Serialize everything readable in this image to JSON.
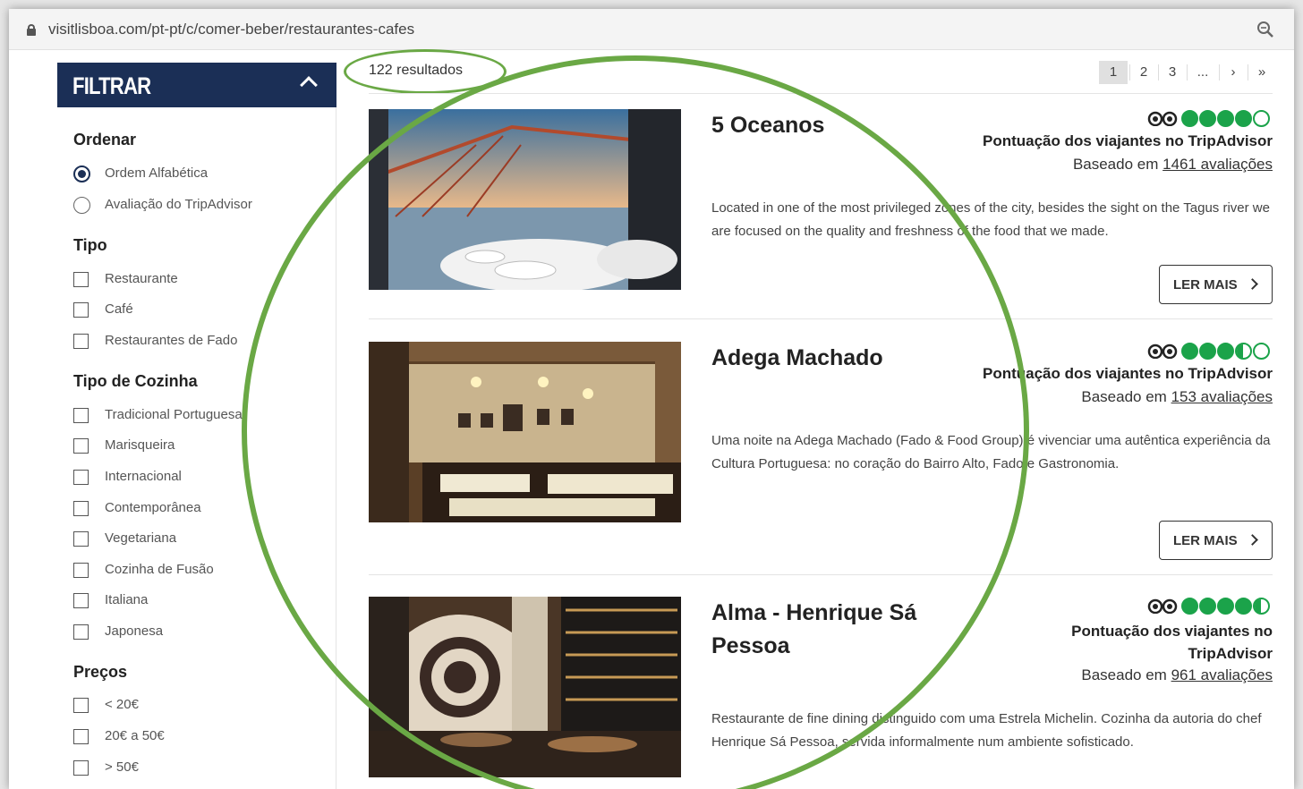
{
  "browser": {
    "url": "visitlisboa.com/pt-pt/c/comer-beber/restaurantes-cafes"
  },
  "sidebar": {
    "title": "FILTRAR",
    "groups": {
      "ordenar": {
        "title": "Ordenar",
        "options": [
          "Ordem Alfabética",
          "Avaliação do TripAdvisor"
        ],
        "selected": "Ordem Alfabética"
      },
      "tipo": {
        "title": "Tipo",
        "options": [
          "Restaurante",
          "Café",
          "Restaurantes de Fado"
        ]
      },
      "cozinha": {
        "title": "Tipo de Cozinha",
        "options": [
          "Tradicional Portuguesa",
          "Marisqueira",
          "Internacional",
          "Contemporânea",
          "Vegetariana",
          "Cozinha de Fusão",
          "Italiana",
          "Japonesa"
        ]
      },
      "precos": {
        "title": "Preços",
        "options": [
          "< 20€",
          "20€ a 50€",
          "> 50€"
        ]
      }
    }
  },
  "results": {
    "count_label": "122 resultados",
    "pagination": [
      "1",
      "2",
      "3",
      "...",
      "›",
      "»"
    ],
    "current_page": "1"
  },
  "colors": {
    "navy": "#1b2f56",
    "tripadvisor_green": "#1ba34a",
    "annotation_green": "#6aa845"
  },
  "listings": [
    {
      "name": "5 Oceanos",
      "rating_bubbles": 4.0,
      "rating_label": "Pontuação dos viajantes no TripAdvisor",
      "based_prefix": "Baseado em",
      "reviews": "1461 avaliações",
      "description": "Located in one of the most privileged zones of the city, besides the sight on the Tagus river we are focused on the quality and freshness of the food that we made.",
      "cta": "LER MAIS"
    },
    {
      "name": "Adega Machado",
      "rating_bubbles": 3.5,
      "rating_label": "Pontuação dos viajantes no TripAdvisor",
      "based_prefix": "Baseado em",
      "reviews": "153 avaliações",
      "description": "Uma noite na Adega Machado (Fado & Food Group) é vivenciar uma autêntica experiência da Cultura Portuguesa: no coração do Bairro Alto, Fado e Gastronomia.",
      "cta": "LER MAIS"
    },
    {
      "name": "Alma - Henrique Sá Pessoa",
      "rating_bubbles": 4.5,
      "rating_label": "Pontuação dos viajantes no TripAdvisor",
      "based_prefix": "Baseado em",
      "reviews": "961 avaliações",
      "description": "Restaurante de fine dining distinguido com uma Estrela Michelin. Cozinha da autoria do chef Henrique Sá Pessoa, servida informalmente num ambiente sofisticado."
    }
  ]
}
